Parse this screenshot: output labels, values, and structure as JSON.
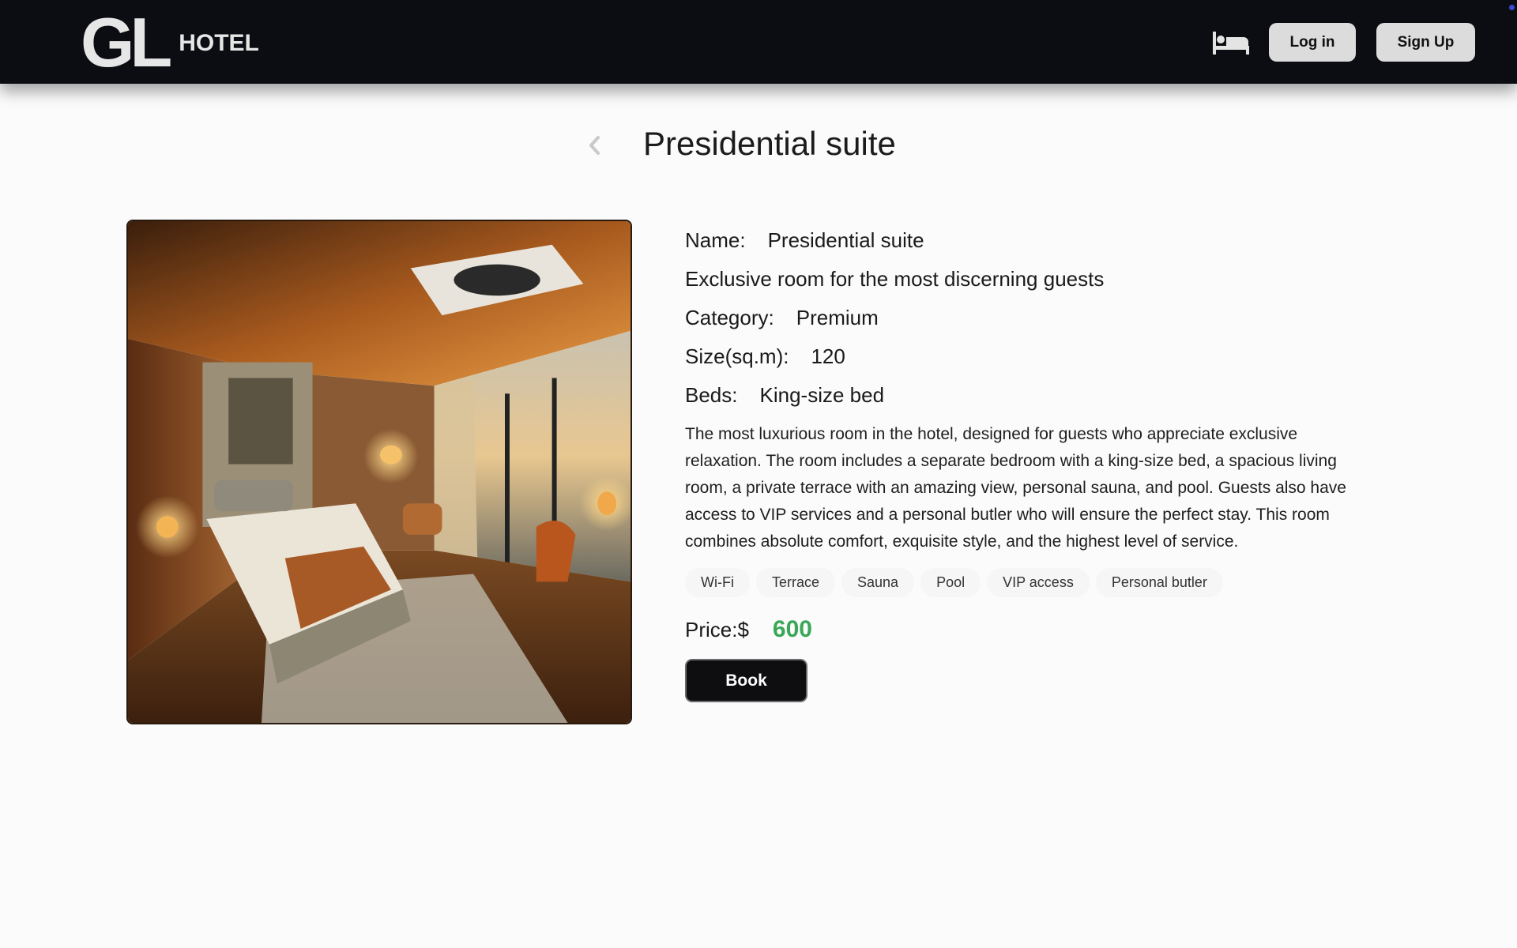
{
  "header": {
    "logo_mark": "GL",
    "logo_text": "HOTEL",
    "login_label": "Log in",
    "signup_label": "Sign Up",
    "icons": [
      "bed-icon"
    ]
  },
  "page": {
    "title": "Presidential suite"
  },
  "room": {
    "name_label": "Name:",
    "name": "Presidential suite",
    "tagline": "Exclusive room for the most discerning guests",
    "category_label": "Category:",
    "category": "Premium",
    "size_label": "Size(sq.m):",
    "size": "120",
    "beds_label": "Beds:",
    "beds": "King-size bed",
    "description": "The most luxurious room in the hotel, designed for guests who appreciate exclusive relaxation. The room includes a separate bedroom with a king-size bed, a spacious living room, a private terrace with an amazing view, personal sauna, and pool. Guests also have access to VIP services and a personal butler who will ensure the perfect stay. This room combines absolute comfort, exquisite style, and the highest level of service.",
    "amenities": [
      "Wi-Fi",
      "Terrace",
      "Sauna",
      "Pool",
      "VIP access",
      "Personal butler"
    ],
    "price_label": "Price:$",
    "price": "600",
    "book_label": "Book"
  },
  "colors": {
    "header_bg": "#0c0d12",
    "price_green": "#3aa757",
    "book_bg": "#0e0e10"
  }
}
